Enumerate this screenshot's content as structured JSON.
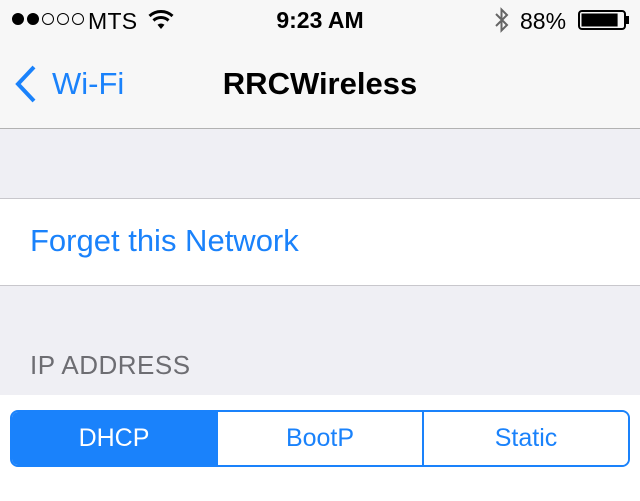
{
  "status_bar": {
    "signal_bars_filled": 2,
    "signal_bars_total": 5,
    "carrier": "MTS",
    "wifi_icon": "wifi-icon",
    "time": "9:23 AM",
    "bluetooth_icon": "bluetooth-icon",
    "battery_percent": "88%",
    "battery_level": 0.88
  },
  "nav": {
    "back_label": "Wi-Fi",
    "back_icon": "chevron-left-icon",
    "title": "RRCWireless"
  },
  "actions": {
    "forget_label": "Forget this Network"
  },
  "ip_section": {
    "header": "IP ADDRESS",
    "modes": [
      "DHCP",
      "BootP",
      "Static"
    ],
    "selected_mode": "DHCP"
  },
  "colors": {
    "accent": "#1a82fb",
    "background": "#efeff4",
    "bar": "#f7f7f7",
    "header_text": "#6d6d72"
  }
}
